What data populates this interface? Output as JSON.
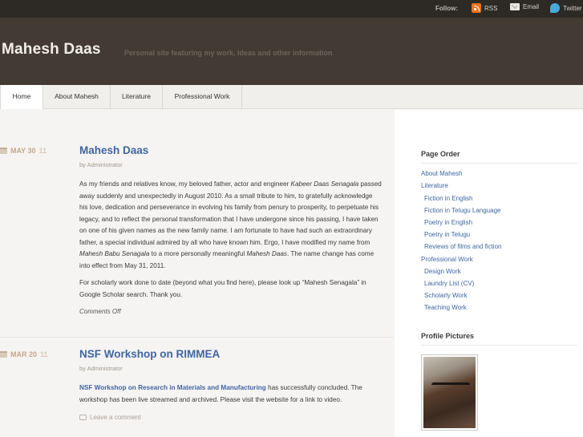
{
  "follow": {
    "label": "Follow:",
    "rss": "RSS",
    "email": "Email",
    "twitter": "Twitter"
  },
  "site": {
    "title": "Mahesh Daas",
    "tagline": "Personal site featuring my work, ideas and other information"
  },
  "nav": [
    "Home",
    "About Mahesh",
    "Literature",
    "Professional Work"
  ],
  "posts": [
    {
      "month": "MAY 30",
      "day": "11",
      "title": "Mahesh Daas",
      "byline": "by Administrator",
      "para1_parts": [
        "As my friends and relatives know, my beloved father, actor and engineer ",
        "Kabeer Daas Senagala",
        " passed away suddenly and unexpectedly in August 2010. As a small tribute to him, to gratefully acknowledge his love, dedication and perseverance in evolving his family from penury to prosperity, to perpetuate his legacy, and to reflect the personal transformation that I have undergone since his passing, I have taken on one of his given names as the new family name. I am fortunate to have had such an extraordinary father, a special individual admired by all who have known him. Ergo, I have modified my name from ",
        "Mahesh Babu Senagala",
        " to a more personally meaningful ",
        "Mahesh Daas",
        ". The name change has come into effect from May 31, 2011."
      ],
      "para2": "For scholarly work done to date (beyond what you find here), please look up “Mahesh Senagala” in Google Scholar search. Thank you.",
      "comments": "Comments Off"
    },
    {
      "month": "MAR 20",
      "day": "11",
      "title": "NSF Workshop on RIMMEA",
      "byline": "by Administrator",
      "para_link": "NSF Workshop on Research in Materials and Manufacturing",
      "para_rest": " has successfully concluded. The workshop has been live streamed and archived. Please visit the website for a link to video.",
      "comment_link": "Leave a comment"
    }
  ],
  "sidebar": {
    "page_order_heading": "Page Order",
    "page_links": [
      "About Mahesh",
      "Literature",
      "Fiction in English",
      "Fiction in Telugu Language",
      "Poetry in English",
      "Poetry in Telugu",
      "Reviews of films and fiction",
      "Professional Work",
      "Design Work",
      "Laundry List (CV)",
      "Scholarly Work",
      "Teaching Work"
    ],
    "profile_heading": "Profile Pictures"
  }
}
